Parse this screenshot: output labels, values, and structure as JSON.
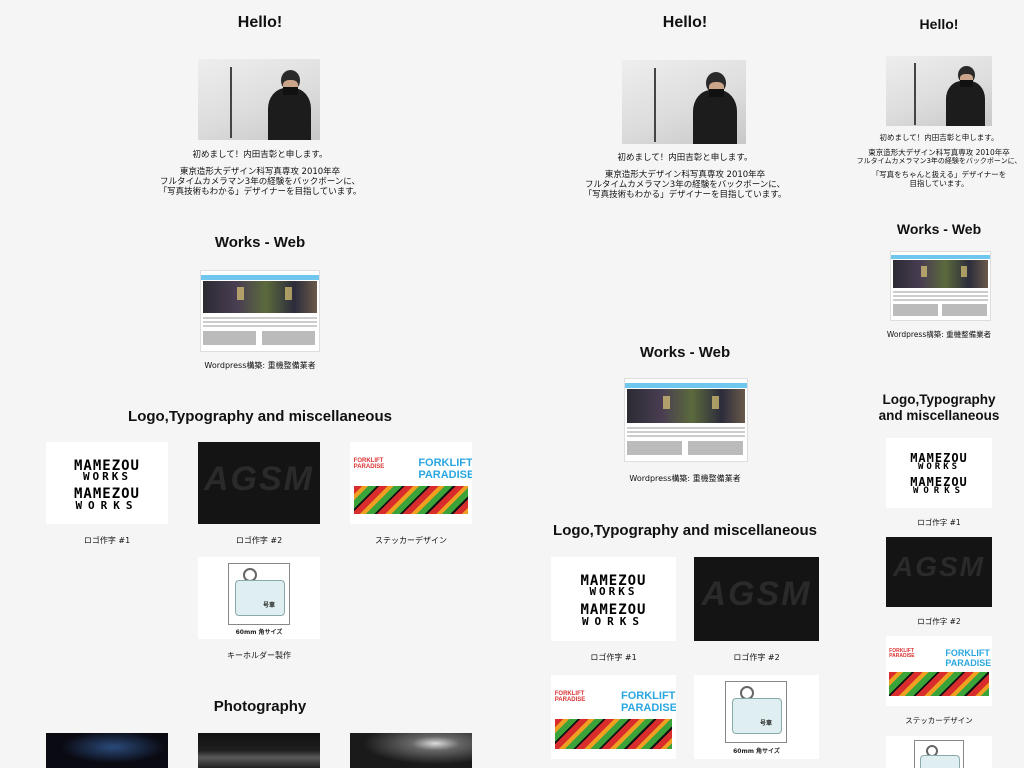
{
  "left": {
    "hello_title": "Hello!",
    "intro_greeting": "初めまして！内田吉彰と申します。",
    "intro_lines": [
      "東京造形大デザイン科写真専攻 2010年卒",
      "フルタイムカメラマン3年の経験をバックボーンに、",
      "「写真技術もわかる」デザイナーを目指しています。"
    ],
    "works_title": "Works - Web",
    "web_caption": "Wordpress構築: 重機整備業者",
    "logo_title": "Logo,Typography and miscellaneous",
    "logo_items": [
      {
        "caption": "ロゴ作字 #1"
      },
      {
        "caption": "ロゴ作字 #2"
      },
      {
        "caption": "ステッカーデザイン"
      },
      {
        "caption": "キーホルダー製作"
      }
    ],
    "photo_title": "Photography"
  },
  "middle": {
    "hello_title": "Hello!",
    "intro_greeting": "初めまして！内田吉彰と申します。",
    "intro_lines": [
      "東京造形大デザイン科写真専攻 2010年卒",
      "フルタイムカメラマン3年の経験をバックボーンに、",
      "「写真技術もわかる」デザイナーを目指しています。"
    ],
    "works_title": "Works - Web",
    "web_caption": "Wordpress構築: 重機整備業者",
    "logo_title": "Logo,Typography and miscellaneous",
    "logo_captions": [
      "ロゴ作字 #1",
      "ロゴ作字 #2"
    ]
  },
  "right": {
    "hello_title": "Hello!",
    "intro_greeting": "初めまして！内田吉彰と申します。",
    "intro_lines": [
      "東京造形大デザイン科写真専攻 2010年卒",
      "フルタイムカメラマン3年の経験をバックボーンに、",
      "「写真をちゃんと扱える」デザイナーを",
      "目指しています。"
    ],
    "works_title": "Works - Web",
    "web_caption": "Wordpress構築: 重機整備業者",
    "logo_title_line1": "Logo,Typography",
    "logo_title_line2": "and miscellaneous",
    "logo_captions": [
      "ロゴ作字 #1",
      "ロゴ作字 #2",
      "ステッカーデザイン"
    ]
  },
  "artwork": {
    "mame_line1": "MAMEZOU",
    "mame_line2": "WORKS",
    "agsm": "AGSM",
    "sticker_repeat": "FORKLIFT PARADISE",
    "sticker_title_1": "FORKLIFT",
    "sticker_title_2": "PARADISE",
    "key_label": "号車",
    "key_size": "60mm 角サイズ"
  },
  "colors": {
    "background": "#f5f5f5",
    "accent_blue": "#2aa7e0",
    "web_nav": "#6fc7ee"
  }
}
